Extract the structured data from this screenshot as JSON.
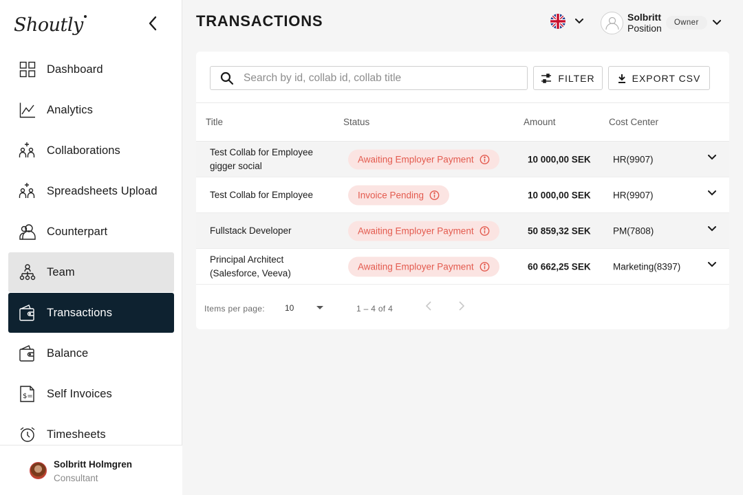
{
  "app": {
    "brand": "Shoutly"
  },
  "sidebar": {
    "items": [
      {
        "label": "Dashboard",
        "icon": "dashboard-icon"
      },
      {
        "label": "Analytics",
        "icon": "analytics-icon"
      },
      {
        "label": "Collaborations",
        "icon": "collaborations-icon"
      },
      {
        "label": "Spreadsheets Upload",
        "icon": "spreadsheets-upload-icon"
      },
      {
        "label": "Counterpart",
        "icon": "counterpart-icon"
      },
      {
        "label": "Team",
        "icon": "team-icon"
      },
      {
        "label": "Transactions",
        "icon": "transactions-icon"
      },
      {
        "label": "Balance",
        "icon": "balance-icon"
      },
      {
        "label": "Self Invoices",
        "icon": "self-invoices-icon"
      },
      {
        "label": "Timesheets",
        "icon": "timesheets-icon"
      }
    ],
    "active_item": "Transactions",
    "hovered_item": "Team",
    "user": {
      "name": "Solbritt Holmgren",
      "role": "Consultant"
    }
  },
  "header": {
    "title": "TRANSACTIONS",
    "language_icon": "uk-flag-icon",
    "account": {
      "name": "Solbritt",
      "position": "Position",
      "badge": "Owner"
    }
  },
  "toolbar": {
    "search_placeholder": "Search by id, collab id, collab title",
    "filter_label": "FILTER",
    "export_label": "EXPORT CSV"
  },
  "table": {
    "columns": [
      "Title",
      "Status",
      "Amount",
      "Cost Center"
    ],
    "rows": [
      {
        "title": "Test Collab for Employee gigger social",
        "status": "Awaiting Employer Payment",
        "amount": "10 000,00 SEK",
        "cost_center": "HR(9907)"
      },
      {
        "title": "Test Collab for Employee",
        "status": "Invoice Pending",
        "amount": "10 000,00 SEK",
        "cost_center": "HR(9907)"
      },
      {
        "title": "Fullstack Developer",
        "status": "Awaiting Employer Payment",
        "amount": "50 859,32 SEK",
        "cost_center": "PM(7808)"
      },
      {
        "title": "Principal Architect (Salesforce, Veeva)",
        "status": "Awaiting Employer Payment",
        "amount": "60 662,25 SEK",
        "cost_center": "Marketing(8397)"
      }
    ]
  },
  "pagination": {
    "items_per_page_label": "Items per page:",
    "items_per_page": "10",
    "range": "1 – 4 of 4"
  },
  "colors": {
    "active_nav_bg": "#0e2230",
    "hover_nav_bg": "#e5e5e5",
    "status_text": "#e35a4e",
    "status_bg": "#fbe4e2"
  }
}
